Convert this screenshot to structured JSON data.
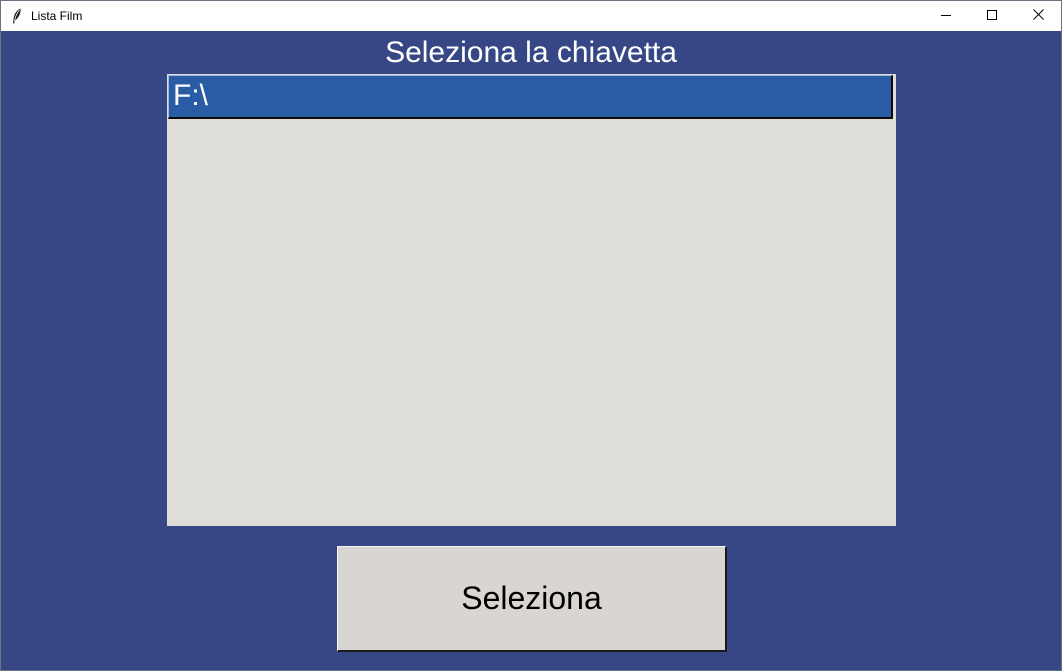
{
  "window": {
    "title": "Lista Film",
    "icons": {
      "app": "feather-icon",
      "minimize": "minimize-icon",
      "maximize": "maximize-icon",
      "close": "close-icon"
    }
  },
  "main": {
    "heading": "Seleziona la chiavetta",
    "drives": [
      {
        "label": "F:\\",
        "selected": true
      }
    ],
    "select_button_label": "Seleziona"
  },
  "colors": {
    "background": "#374785",
    "listbox": "#dfddd8",
    "selection": "#2a5ca6",
    "button": "#d9d6d1"
  }
}
